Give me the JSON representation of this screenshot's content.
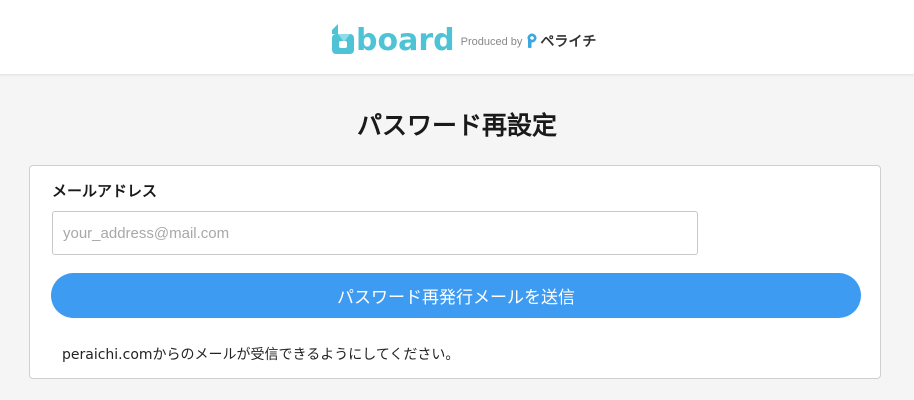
{
  "header": {
    "logo_word": "board",
    "produced_by": "Produced by",
    "peraichi_name": "ペライチ",
    "brand_color": "#4fc3d6"
  },
  "page": {
    "title": "パスワード再設定"
  },
  "form": {
    "email_label": "メールアドレス",
    "email_placeholder": "your_address@mail.com",
    "email_value": "",
    "submit_label": "パスワード再発行メールを送信",
    "submit_color": "#3d9bf2",
    "note": "peraichi.comからのメールが受信できるようにしてください。"
  }
}
